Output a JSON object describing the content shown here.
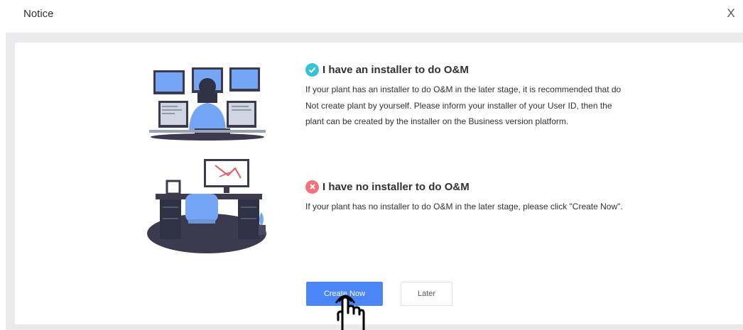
{
  "dialog": {
    "title": "Notice",
    "close_label": "X"
  },
  "options": [
    {
      "status": "check",
      "status_color": "#36c2d5",
      "title": "I have an installer to do O&M",
      "description": "If your plant has an installer to do O&M in the later stage, it is recommended that do Not create plant by yourself. Please inform your installer of your User ID, then the plant can be created by the installer on the Business version platform."
    },
    {
      "status": "cross",
      "status_color": "#f5707a",
      "title": "I have no installer to do O&M",
      "description": "If your plant has no installer to do O&M in the later stage, please click \"Create Now\"."
    }
  ],
  "buttons": {
    "create_now": "Create Now",
    "later": "Later"
  },
  "colors": {
    "primary": "#4a86f7",
    "illustration_blue": "#75a6f5",
    "illustration_dark": "#3b3a4e"
  },
  "icons": {
    "check": "check-icon",
    "cross": "cross-icon",
    "close": "close-icon",
    "cursor": "hand-pointer-icon"
  }
}
